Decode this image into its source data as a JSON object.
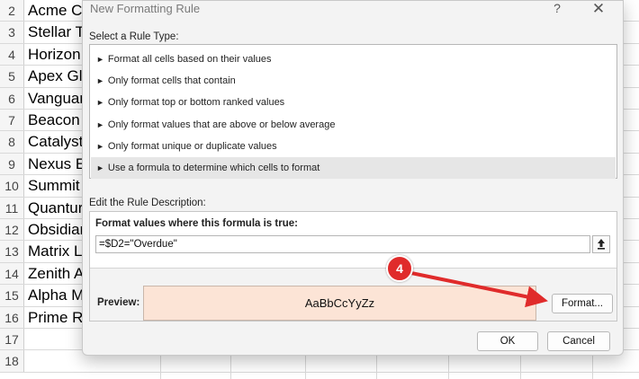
{
  "spreadsheet": {
    "rows": [
      {
        "num": "2",
        "text": "Acme Co"
      },
      {
        "num": "3",
        "text": "Stellar T"
      },
      {
        "num": "4",
        "text": "Horizon"
      },
      {
        "num": "5",
        "text": "Apex Glo"
      },
      {
        "num": "6",
        "text": "Vanguar"
      },
      {
        "num": "7",
        "text": "Beacon"
      },
      {
        "num": "8",
        "text": "Catalyst"
      },
      {
        "num": "9",
        "text": "Nexus Er"
      },
      {
        "num": "10",
        "text": "Summit"
      },
      {
        "num": "11",
        "text": "Quantur"
      },
      {
        "num": "12",
        "text": "Obsidiar"
      },
      {
        "num": "13",
        "text": "Matrix Lo"
      },
      {
        "num": "14",
        "text": "Zenith A"
      },
      {
        "num": "15",
        "text": "Alpha M"
      },
      {
        "num": "16",
        "text": "Prime Re"
      },
      {
        "num": "17",
        "text": ""
      },
      {
        "num": "18",
        "text": ""
      }
    ]
  },
  "dialog": {
    "title": "New Formatting Rule",
    "help_label": "?",
    "close_label": "✕",
    "rule_type_label": "Select a Rule Type:",
    "rule_types": [
      {
        "label": "Format all cells based on their values",
        "selected": false
      },
      {
        "label": "Only format cells that contain",
        "selected": false
      },
      {
        "label": "Only format top or bottom ranked values",
        "selected": false
      },
      {
        "label": "Only format values that are above or below average",
        "selected": false
      },
      {
        "label": "Only format unique or duplicate values",
        "selected": false
      },
      {
        "label": "Use a formula to determine which cells to format",
        "selected": true
      }
    ],
    "rule_description_label": "Edit the Rule Description:",
    "formula_label": "Format values where this formula is true:",
    "formula_value": "=$D2=\"Overdue\"",
    "preview_label": "Preview:",
    "preview_text": "AaBbCcYyZz",
    "preview_color": "#fce4d6",
    "format_button": "Format...",
    "ok_button": "OK",
    "cancel_button": "Cancel"
  },
  "annotation": {
    "step_number": "4",
    "color": "#e02b2b"
  }
}
